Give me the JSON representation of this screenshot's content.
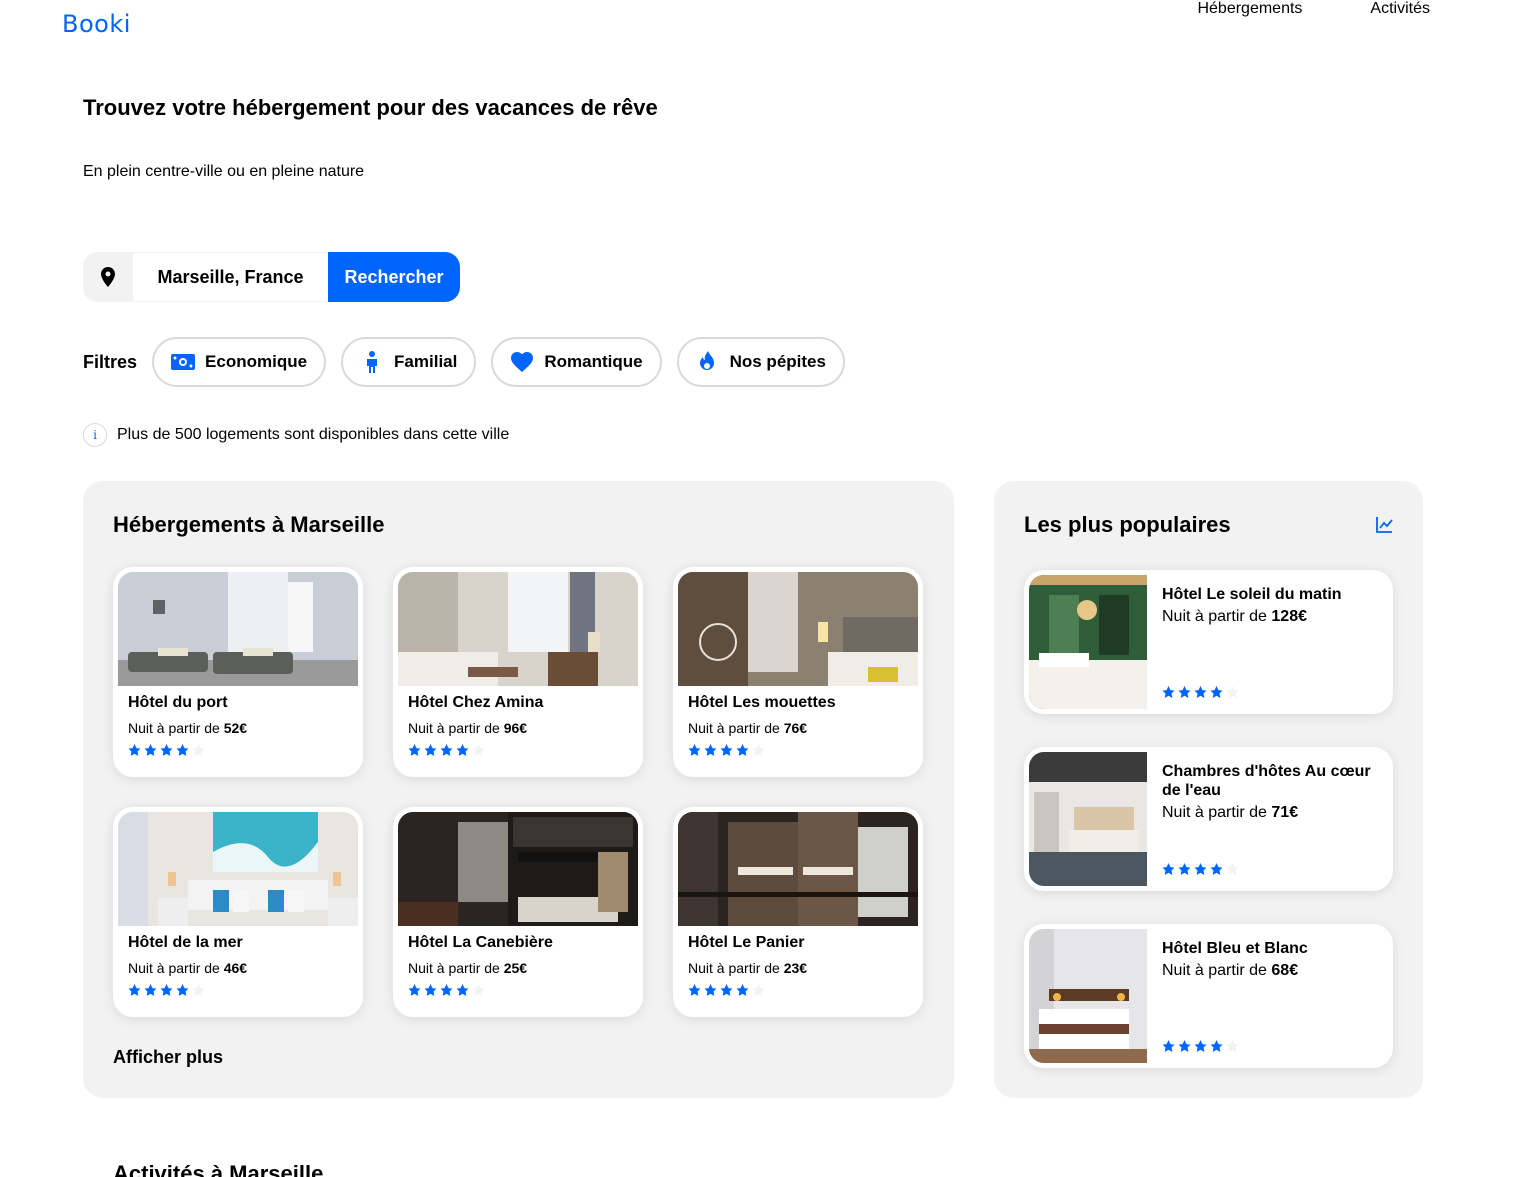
{
  "brand": {
    "logo": "Booki",
    "color": "#0065FC"
  },
  "nav": {
    "items": [
      "Hébergements",
      "Activités"
    ]
  },
  "hero": {
    "title": "Trouvez votre hébergement pour des vacances de rêve",
    "subtitle": "En plein centre-ville ou en pleine nature"
  },
  "search": {
    "icon": "location-pin-icon",
    "location": "Marseille, France",
    "button": "Rechercher"
  },
  "filters": {
    "label": "Filtres",
    "items": [
      {
        "label": "Economique",
        "icon": "money-icon"
      },
      {
        "label": "Familial",
        "icon": "child-icon"
      },
      {
        "label": "Romantique",
        "icon": "heart-icon"
      },
      {
        "label": "Nos pépites",
        "icon": "fire-icon"
      }
    ]
  },
  "info": {
    "text": "Plus de 500 logements sont disponibles dans cette ville"
  },
  "listing": {
    "title": "Hébergements à Marseille",
    "price_prefix": "Nuit à partir de",
    "items": [
      {
        "name": "Hôtel du port",
        "price": "52€",
        "rating": 4
      },
      {
        "name": "Hôtel Chez Amina",
        "price": "96€",
        "rating": 4
      },
      {
        "name": "Hôtel Les mouettes",
        "price": "76€",
        "rating": 4
      },
      {
        "name": "Hôtel de la mer",
        "price": "46€",
        "rating": 4
      },
      {
        "name": "Hôtel La Canebière",
        "price": "25€",
        "rating": 4
      },
      {
        "name": "Hôtel Le Panier",
        "price": "23€",
        "rating": 4
      }
    ],
    "more": "Afficher plus"
  },
  "popular": {
    "title": "Les plus populaires",
    "icon": "trending-chart-icon",
    "price_prefix": "Nuit à partir de",
    "items": [
      {
        "name": "Hôtel Le soleil du matin",
        "price": "128€",
        "rating": 4
      },
      {
        "name": "Chambres d'hôtes Au cœur de l'eau",
        "price": "71€",
        "rating": 4
      },
      {
        "name": "Hôtel Bleu et Blanc",
        "price": "68€",
        "rating": 4
      }
    ]
  },
  "activities": {
    "title": "Activités à Marseille"
  },
  "colors": {
    "accent": "#0065FC",
    "panel": "#F2F2F2",
    "star_off": "#F2F2F2"
  }
}
